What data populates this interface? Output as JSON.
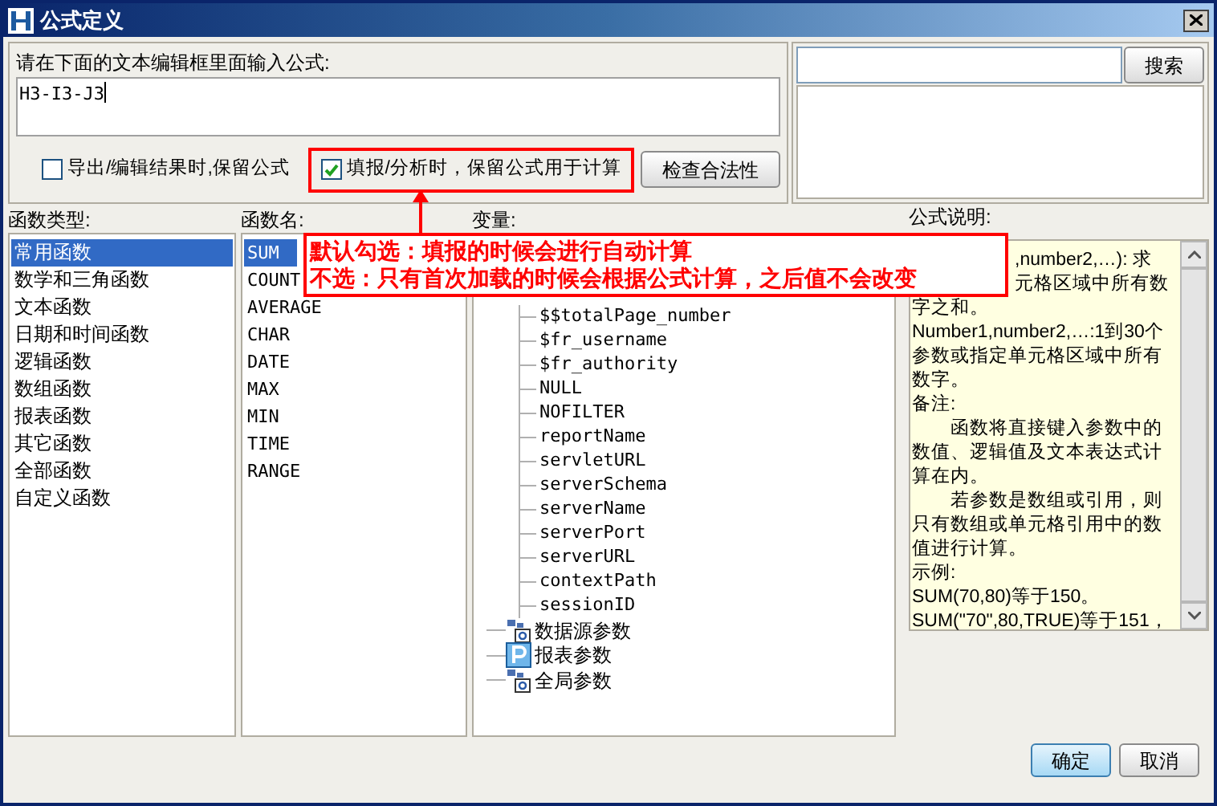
{
  "window": {
    "title": "公式定义"
  },
  "editor": {
    "label": "请在下面的文本编辑框里面输入公式:",
    "value": "H3-I3-J3"
  },
  "options": [
    {
      "label": "导出/编辑结果时,保留公式",
      "checked": false,
      "highlighted": false
    },
    {
      "label": "填报/分析时，保留公式用于计算",
      "checked": true,
      "highlighted": true
    }
  ],
  "check_button": "检查合法性",
  "search": {
    "button": "搜索"
  },
  "function_types": {
    "label": "函数类型:",
    "items": [
      {
        "label": "常用函数",
        "selected": true
      },
      {
        "label": "数学和三角函数",
        "selected": false
      },
      {
        "label": "文本函数",
        "selected": false
      },
      {
        "label": "日期和时间函数",
        "selected": false
      },
      {
        "label": "逻辑函数",
        "selected": false
      },
      {
        "label": "数组函数",
        "selected": false
      },
      {
        "label": "报表函数",
        "selected": false
      },
      {
        "label": "其它函数",
        "selected": false
      },
      {
        "label": "全部函数",
        "selected": false
      },
      {
        "label": "自定义函数",
        "selected": false
      }
    ]
  },
  "function_names": {
    "label": "函数名:",
    "items": [
      {
        "label": "SUM",
        "selected": true
      },
      {
        "label": "COUNT",
        "selected": false
      },
      {
        "label": "AVERAGE",
        "selected": false
      },
      {
        "label": "CHAR",
        "selected": false
      },
      {
        "label": "DATE",
        "selected": false
      },
      {
        "label": "MAX",
        "selected": false
      },
      {
        "label": "MIN",
        "selected": false
      },
      {
        "label": "TIME",
        "selected": false
      },
      {
        "label": "RANGE",
        "selected": false
      }
    ]
  },
  "variables": {
    "label": "变量:",
    "tree": [
      {
        "children": [
          {
            "label": "$$totalPage_number"
          },
          {
            "label": "$fr_username"
          },
          {
            "label": "$fr_authority"
          },
          {
            "label": "NULL"
          },
          {
            "label": "NOFILTER"
          },
          {
            "label": "reportName"
          },
          {
            "label": "servletURL"
          },
          {
            "label": "serverSchema"
          },
          {
            "label": "serverName"
          },
          {
            "label": "serverPort"
          },
          {
            "label": "serverURL"
          },
          {
            "label": "contextPath"
          },
          {
            "label": "sessionID"
          }
        ]
      },
      {
        "label": "数据源参数",
        "kind": "group"
      },
      {
        "label": "报表参数",
        "kind": "param"
      },
      {
        "label": "全局参数",
        "kind": "group"
      }
    ]
  },
  "description": {
    "label": "公式说明:",
    "lines": [
      {
        "text": ",number2,…): 求",
        "kind": "covered"
      },
      {
        "text": "元格区域中所有数",
        "kind": "covered"
      },
      {
        "text": "字之和。",
        "kind": "plain"
      },
      {
        "text": "Number1,number2,…:1到30个",
        "kind": "plain"
      },
      {
        "text": "参数或指定单元格区域中所有",
        "kind": "plain"
      },
      {
        "text": "数字。",
        "kind": "plain"
      },
      {
        "text": "备注:",
        "kind": "plain"
      },
      {
        "text": "函数将直接键入参数中的",
        "kind": "indent"
      },
      {
        "text": "数值、逻辑值及文本表达式计",
        "kind": "plain"
      },
      {
        "text": "算在内。",
        "kind": "plain"
      },
      {
        "text": "若参数是数组或引用，则",
        "kind": "indent"
      },
      {
        "text": "只有数组或单元格引用中的数",
        "kind": "plain"
      },
      {
        "text": "值进行计算。",
        "kind": "plain"
      },
      {
        "text": "示例:",
        "kind": "plain"
      },
      {
        "text": "SUM(70,80)等于150。",
        "kind": "plain"
      },
      {
        "text": "SUM(\"70\",80,TRUE)等于151，",
        "kind": "plain"
      }
    ]
  },
  "callout": [
    "默认勾选：填报的时候会进行自动计算",
    "不选：只有首次加载的时候会根据公式计算，之后值不会改变"
  ],
  "buttons": [
    "确定",
    "取消"
  ]
}
